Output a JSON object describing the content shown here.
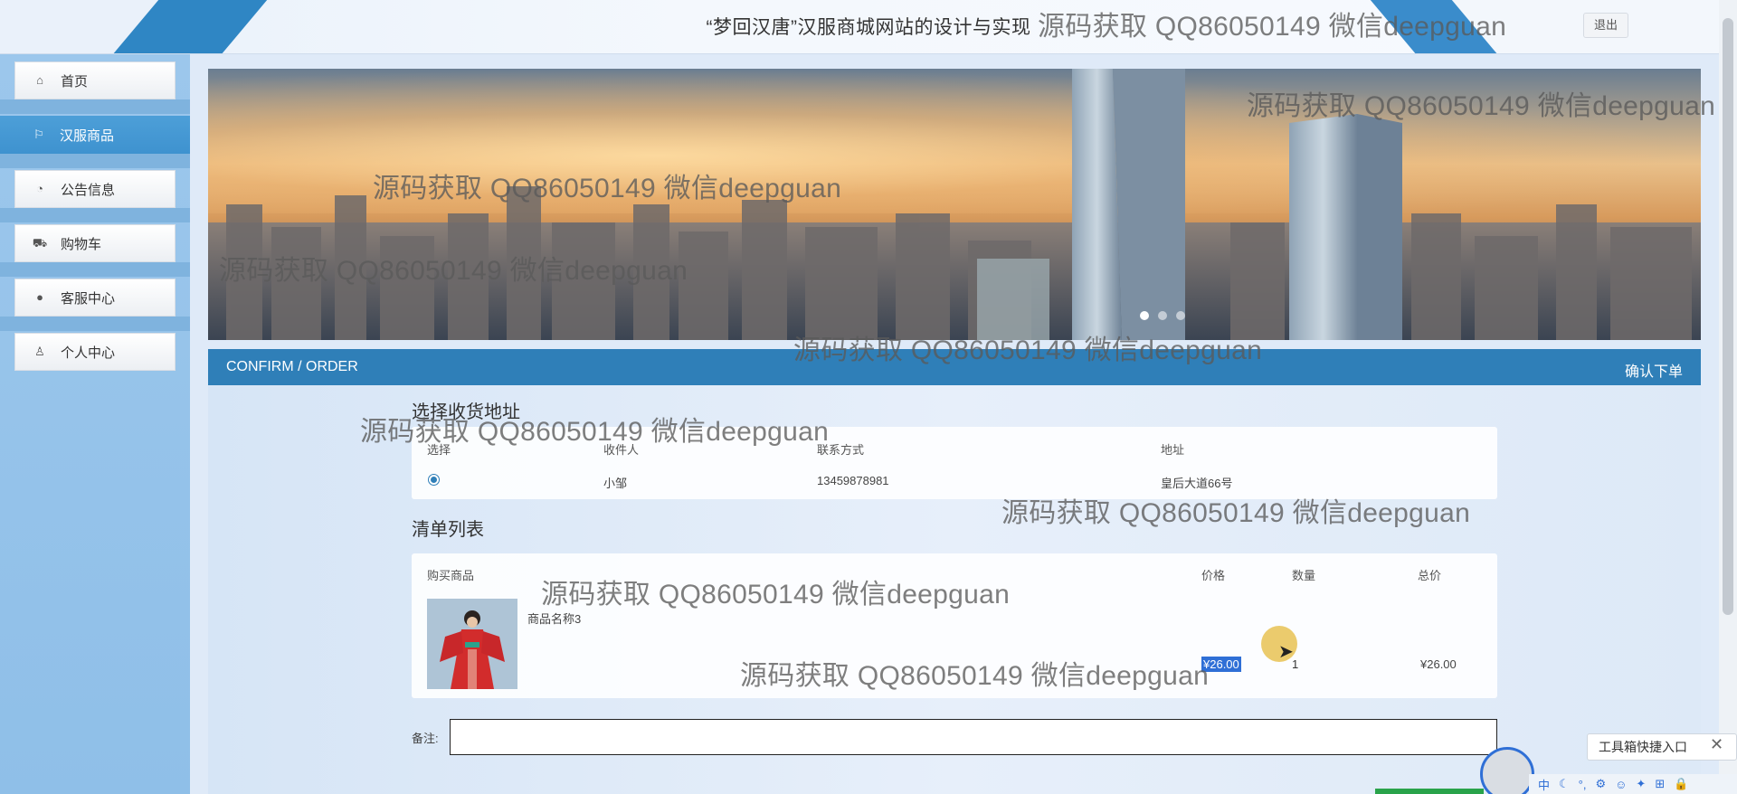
{
  "header": {
    "title": "“梦回汉唐”汉服商城网站的设计与实现",
    "logout_label": "退出"
  },
  "sidebar": {
    "items": [
      {
        "label": "首页",
        "icon": "home-icon"
      },
      {
        "label": "汉服商品",
        "icon": "flag-icon",
        "active": true
      },
      {
        "label": "公告信息",
        "icon": "gauge-icon"
      },
      {
        "label": "购物车",
        "icon": "cart-icon"
      },
      {
        "label": "客服中心",
        "icon": "support-icon"
      },
      {
        "label": "个人中心",
        "icon": "user-icon"
      }
    ]
  },
  "banner": {
    "slides": 3,
    "active_slide": 1
  },
  "section": {
    "title_en": "CONFIRM / ORDER",
    "title_zh": "确认下单"
  },
  "address": {
    "heading": "选择收货地址",
    "columns": [
      "选择",
      "收件人",
      "联系方式",
      "地址"
    ],
    "rows": [
      {
        "selected": true,
        "name": "小邹",
        "phone": "13459878981",
        "address": "皇后大道66号"
      }
    ]
  },
  "order": {
    "heading": "清单列表",
    "columns": [
      "购买商品",
      "价格",
      "数量",
      "总价"
    ],
    "items": [
      {
        "name": "商品名称3",
        "price": "¥26.00",
        "quantity": "1",
        "total": "¥26.00"
      }
    ]
  },
  "remark": {
    "label": "备注:",
    "value": ""
  },
  "toolbox": {
    "label": "工具箱快捷入口",
    "close": "✕",
    "tray_glyphs": [
      "中",
      "☾",
      "°,",
      "⚙",
      "☺",
      "✦",
      "⊞",
      "🔒"
    ]
  },
  "watermark": {
    "text": "源码获取 QQ86050149 微信deepguan"
  },
  "colors": {
    "accent": "#2f7fb8",
    "sidebar_bg": "#9cc7ec",
    "active_item": "#4d9fd8"
  }
}
